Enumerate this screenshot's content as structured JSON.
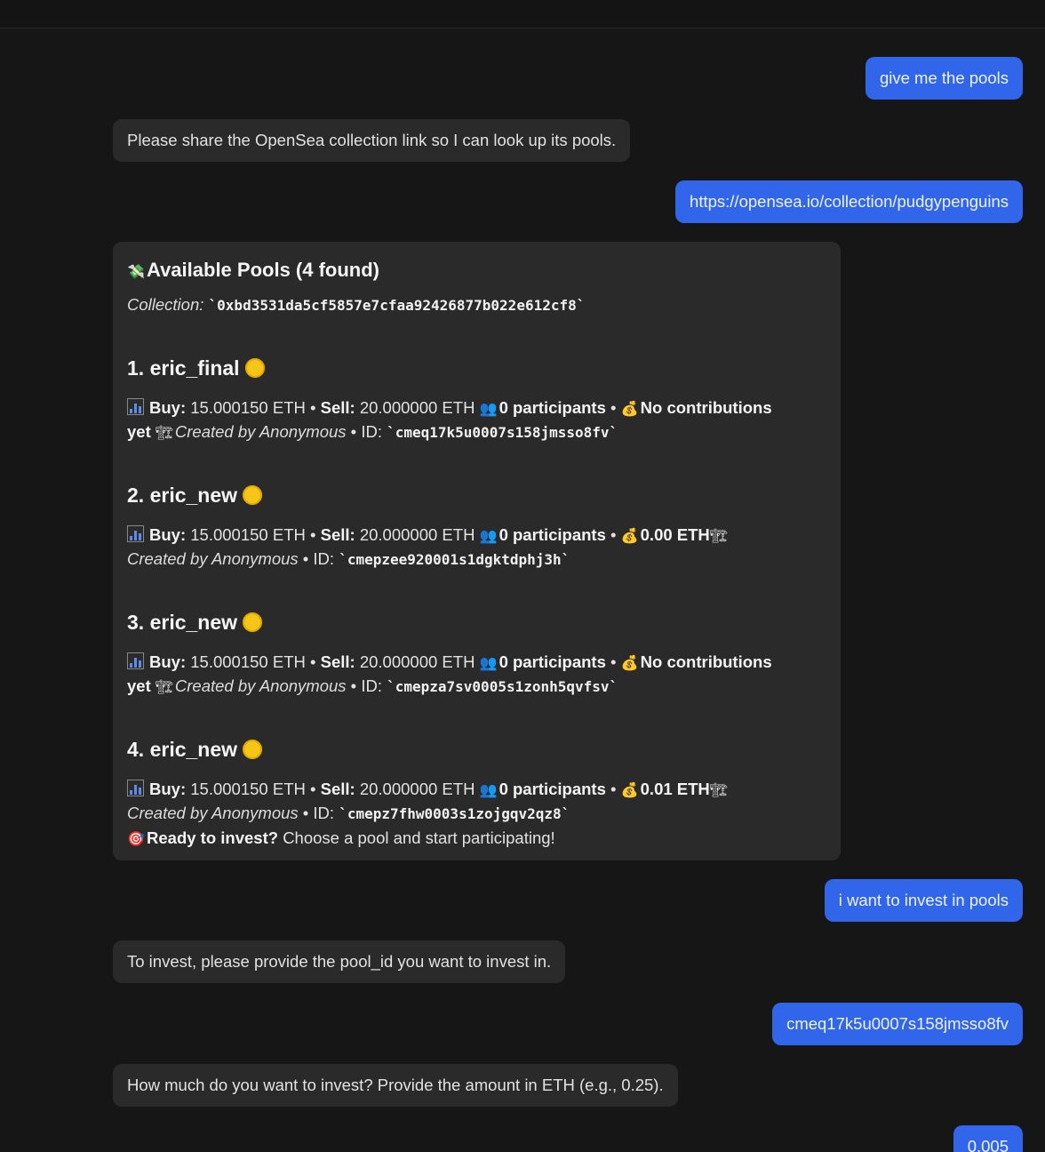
{
  "messages": {
    "m1_user": "give me the pools",
    "m2_bot": "Please share the OpenSea collection link so I can look up its pools.",
    "m3_user": "https://opensea.io/collection/pudgypenguins",
    "m5_user": "i want to invest in pools",
    "m6_bot": "To invest, please provide the pool_id you want to invest in.",
    "m7_user": "cmeq17k5u0007s158jmsso8fv",
    "m8_bot": "How much do you want to invest? Provide the amount in ETH (e.g., 0.25).",
    "m9_user": "0.005"
  },
  "pools_card": {
    "title": "Available Pools (4 found)",
    "collection_label": "Collection:",
    "collection_address": "`0xbd3531da5cf5857e7cfaa92426877b022e612cf8`",
    "buy_label": "Buy:",
    "sell_label": "Sell:",
    "created_by": "Created by Anonymous",
    "id_label": "ID:",
    "pools": [
      {
        "heading": "1. eric_final",
        "buy": "15.000150 ETH",
        "sell": "20.000000 ETH",
        "participants": "0 participants",
        "contrib_a": "No contributions",
        "contrib_b": "yet",
        "id": "`cmeq17k5u0007s158jmsso8fv`"
      },
      {
        "heading": "2. eric_new",
        "buy": "15.000150 ETH",
        "sell": "20.000000 ETH",
        "participants": "0 participants",
        "contrib": "0.00 ETH",
        "id": "`cmepzee920001s1dgktdphj3h`"
      },
      {
        "heading": "3. eric_new",
        "buy": "15.000150 ETH",
        "sell": "20.000000 ETH",
        "participants": "0 participants",
        "contrib_a": "No contributions",
        "contrib_b": "yet",
        "id": "`cmepza7sv0005s1zonh5qvfsv`"
      },
      {
        "heading": "4. eric_new",
        "buy": "15.000150 ETH",
        "sell": "20.000000 ETH",
        "participants": "0 participants",
        "contrib": "0.01 ETH",
        "id": "`cmepz7fhw0003s1zojgqv2qz8`"
      }
    ],
    "cta_bold": "Ready to invest?",
    "cta_text": "Choose a pool and start participating!"
  },
  "icons": {
    "title": "money-with-wings-icon",
    "chart": "bar-chart-icon",
    "people": "busts-icon",
    "bag": "money-bag-icon",
    "crane": "construction-crane-icon",
    "coin": "yellow-circle-icon",
    "target": "direct-hit-icon"
  },
  "colors": {
    "user_bubble": "#3166ea",
    "bot_bubble": "#2a2a2a",
    "background": "#161616"
  }
}
